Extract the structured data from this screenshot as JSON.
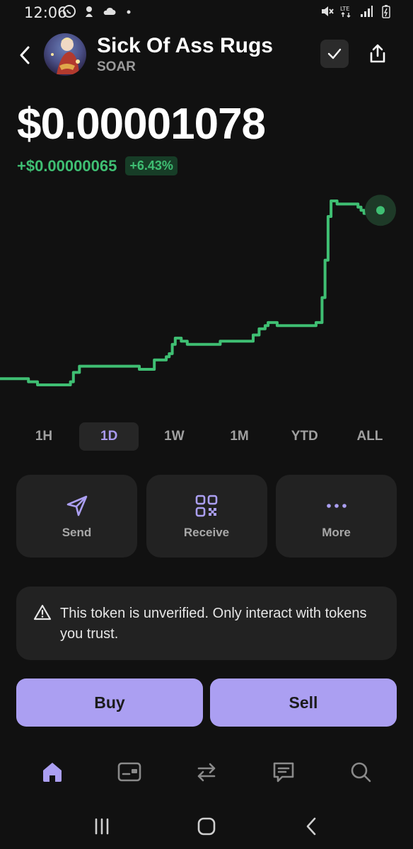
{
  "status_bar": {
    "time": "12:06",
    "left_icons": [
      "whatsapp-icon",
      "alien-icon",
      "cloud-icon",
      "dot-icon"
    ],
    "right_icons": [
      "mute-icon",
      "lte-icon",
      "signal-icon",
      "battery-icon"
    ],
    "lte_label": "LTE"
  },
  "header": {
    "token_name": "Sick Of Ass Rugs",
    "token_symbol": "SOAR",
    "back_icon": "chevron-left-icon",
    "verify_icon": "check-icon",
    "share_icon": "share-icon"
  },
  "price": {
    "value": "$0.00001078",
    "change_abs": "+$0.00000065",
    "change_pct": "+6.43%"
  },
  "colors": {
    "accent": "#ab9ff2",
    "positive": "#3fbf73",
    "background": "#111111",
    "card": "#222222",
    "active_tab_text": "#a99af0"
  },
  "chart_data": {
    "type": "line",
    "series": [
      {
        "values": [
          46,
          46,
          46,
          46,
          46,
          46,
          46,
          46,
          46,
          46,
          45,
          45,
          45,
          44,
          44,
          44,
          44,
          44,
          44,
          44,
          44,
          44,
          44,
          44,
          45,
          48,
          48,
          50,
          50,
          50,
          50,
          50,
          50,
          50,
          50,
          50,
          50,
          50,
          50,
          50,
          50,
          50,
          50,
          50,
          50,
          50,
          50,
          49,
          49,
          49,
          49,
          49,
          52,
          52,
          52,
          52,
          53,
          54,
          57,
          59,
          59,
          58,
          58,
          57,
          57,
          57,
          57,
          57,
          57,
          57,
          57,
          57,
          57,
          57,
          58,
          58,
          58,
          58,
          58,
          58,
          58,
          58,
          58,
          58,
          58,
          60,
          60,
          62,
          62,
          63,
          64,
          64,
          64,
          63,
          63,
          63,
          63,
          63,
          63,
          63,
          63,
          63,
          63,
          63,
          63,
          63,
          64,
          64,
          72,
          84,
          98,
          103,
          103,
          102,
          102,
          102,
          102,
          102,
          102,
          102,
          101,
          100,
          99,
          99,
          99,
          100,
          100,
          100
        ]
      }
    ],
    "selected_range": "1D",
    "last_point_highlighted": true,
    "grid": false,
    "axes_visible": false
  },
  "time_ranges": [
    {
      "label": "1H",
      "active": false
    },
    {
      "label": "1D",
      "active": true
    },
    {
      "label": "1W",
      "active": false
    },
    {
      "label": "1M",
      "active": false
    },
    {
      "label": "YTD",
      "active": false
    },
    {
      "label": "ALL",
      "active": false
    }
  ],
  "actions": [
    {
      "label": "Send",
      "icon": "send-icon"
    },
    {
      "label": "Receive",
      "icon": "qr-code-icon"
    },
    {
      "label": "More",
      "icon": "more-dots-icon"
    }
  ],
  "warning": {
    "text": "This token is unverified. Only interact with tokens you trust.",
    "icon": "warning-triangle-icon"
  },
  "trade": {
    "buy_label": "Buy",
    "sell_label": "Sell"
  },
  "bottom_nav": [
    {
      "icon": "home-icon",
      "active": true
    },
    {
      "icon": "wallet-card-icon",
      "active": false
    },
    {
      "icon": "swap-icon",
      "active": false
    },
    {
      "icon": "chat-icon",
      "active": false
    },
    {
      "icon": "search-icon",
      "active": false
    }
  ],
  "system_nav": [
    "recents-icon",
    "home-button-icon",
    "back-icon"
  ]
}
